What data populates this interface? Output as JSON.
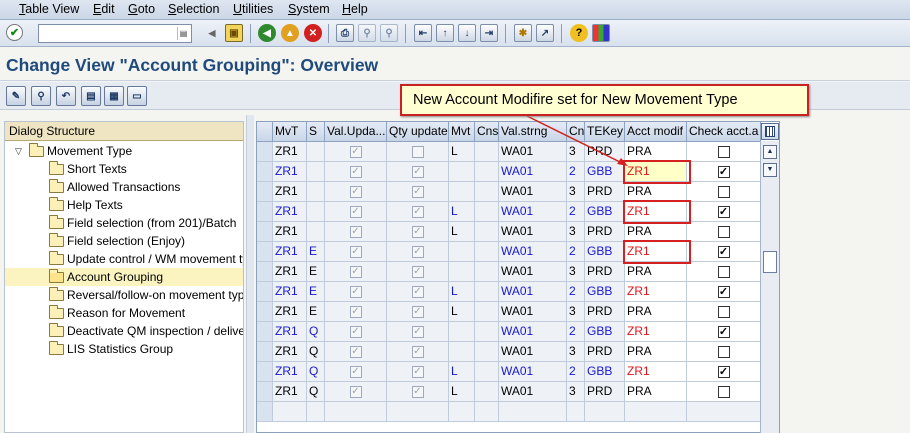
{
  "menu": [
    "Table View",
    "Edit",
    "Goto",
    "Selection",
    "Utilities",
    "System",
    "Help"
  ],
  "title": "Change View \"Account Grouping\": Overview",
  "callout": "New Account Modifire set for New Movement Type",
  "colors": {
    "title": "#1f4a7c",
    "tree_selected": "#fbf4c1",
    "blue_row": "#1818d0",
    "red_highlight": "#d42020"
  },
  "toolbar_icons": [
    "enter-icon",
    "command-field",
    "back-icon",
    "save-icon",
    "back-arrow-icon",
    "exit-icon",
    "cancel-icon",
    "print-icon",
    "find-icon",
    "find-next-icon",
    "first-page-icon",
    "previous-page-icon",
    "next-page-icon",
    "last-page-icon",
    "new-session-icon",
    "shortcut-icon",
    "help-icon",
    "customize-layout-icon"
  ],
  "app_toolbar_icons": [
    "edit-toggle-icon",
    "details-icon",
    "undo-change-icon",
    "select-all-icon",
    "select-block-icon",
    "deselect-all-icon"
  ],
  "tree": {
    "title": "Dialog Structure",
    "root": "Movement Type",
    "children": [
      "Short Texts",
      "Allowed Transactions",
      "Help Texts",
      "Field selection (from 201)/Batch",
      "Field selection (Enjoy)",
      "Update control / WM movement ty",
      "Account Grouping",
      "Reversal/follow-on movement typ",
      "Reason for Movement",
      "Deactivate QM inspection / delive",
      "LIS Statistics Group"
    ],
    "selected": "Account Grouping"
  },
  "table": {
    "columns": [
      "MvT",
      "S",
      "Val.Upda...",
      "Qty update",
      "Mvt",
      "Cns",
      "Val.strng",
      "Cn",
      "TEKey",
      "Acct modif",
      "Check acct.a"
    ],
    "rows": [
      {
        "mvt": "ZR1",
        "s": "",
        "mvt2": "L",
        "cns": "",
        "valstr": "WA01",
        "cn": "3",
        "tekey": "PRD",
        "acct": "PRA",
        "check": false,
        "blue": false,
        "red": false,
        "qty": false
      },
      {
        "mvt": "ZR1",
        "s": "",
        "mvt2": "",
        "cns": "",
        "valstr": "WA01",
        "cn": "2",
        "tekey": "GBB",
        "acct": "ZR1",
        "check": true,
        "blue": true,
        "red": true,
        "qty": true
      },
      {
        "mvt": "ZR1",
        "s": "",
        "mvt2": "",
        "cns": "",
        "valstr": "WA01",
        "cn": "3",
        "tekey": "PRD",
        "acct": "PRA",
        "check": false,
        "blue": false,
        "red": false,
        "qty": true
      },
      {
        "mvt": "ZR1",
        "s": "",
        "mvt2": "L",
        "cns": "",
        "valstr": "WA01",
        "cn": "2",
        "tekey": "GBB",
        "acct": "ZR1",
        "check": true,
        "blue": true,
        "red": true,
        "qty": true
      },
      {
        "mvt": "ZR1",
        "s": "",
        "mvt2": "L",
        "cns": "",
        "valstr": "WA01",
        "cn": "3",
        "tekey": "PRD",
        "acct": "PRA",
        "check": false,
        "blue": false,
        "red": false,
        "qty": true
      },
      {
        "mvt": "ZR1",
        "s": "E",
        "mvt2": "",
        "cns": "",
        "valstr": "WA01",
        "cn": "2",
        "tekey": "GBB",
        "acct": "ZR1",
        "check": true,
        "blue": true,
        "red": true,
        "qty": true
      },
      {
        "mvt": "ZR1",
        "s": "E",
        "mvt2": "",
        "cns": "",
        "valstr": "WA01",
        "cn": "3",
        "tekey": "PRD",
        "acct": "PRA",
        "check": false,
        "blue": false,
        "red": false,
        "qty": true
      },
      {
        "mvt": "ZR1",
        "s": "E",
        "mvt2": "L",
        "cns": "",
        "valstr": "WA01",
        "cn": "2",
        "tekey": "GBB",
        "acct": "ZR1",
        "check": true,
        "blue": true,
        "red": true,
        "qty": true
      },
      {
        "mvt": "ZR1",
        "s": "E",
        "mvt2": "L",
        "cns": "",
        "valstr": "WA01",
        "cn": "3",
        "tekey": "PRD",
        "acct": "PRA",
        "check": false,
        "blue": false,
        "red": false,
        "qty": true
      },
      {
        "mvt": "ZR1",
        "s": "Q",
        "mvt2": "",
        "cns": "",
        "valstr": "WA01",
        "cn": "2",
        "tekey": "GBB",
        "acct": "ZR1",
        "check": true,
        "blue": true,
        "red": true,
        "qty": true
      },
      {
        "mvt": "ZR1",
        "s": "Q",
        "mvt2": "",
        "cns": "",
        "valstr": "WA01",
        "cn": "3",
        "tekey": "PRD",
        "acct": "PRA",
        "check": false,
        "blue": false,
        "red": false,
        "qty": true
      },
      {
        "mvt": "ZR1",
        "s": "Q",
        "mvt2": "L",
        "cns": "",
        "valstr": "WA01",
        "cn": "2",
        "tekey": "GBB",
        "acct": "ZR1",
        "check": true,
        "blue": true,
        "red": true,
        "qty": true
      },
      {
        "mvt": "ZR1",
        "s": "Q",
        "mvt2": "L",
        "cns": "",
        "valstr": "WA01",
        "cn": "3",
        "tekey": "PRD",
        "acct": "PRA",
        "check": false,
        "blue": false,
        "red": false,
        "qty": true
      }
    ]
  }
}
